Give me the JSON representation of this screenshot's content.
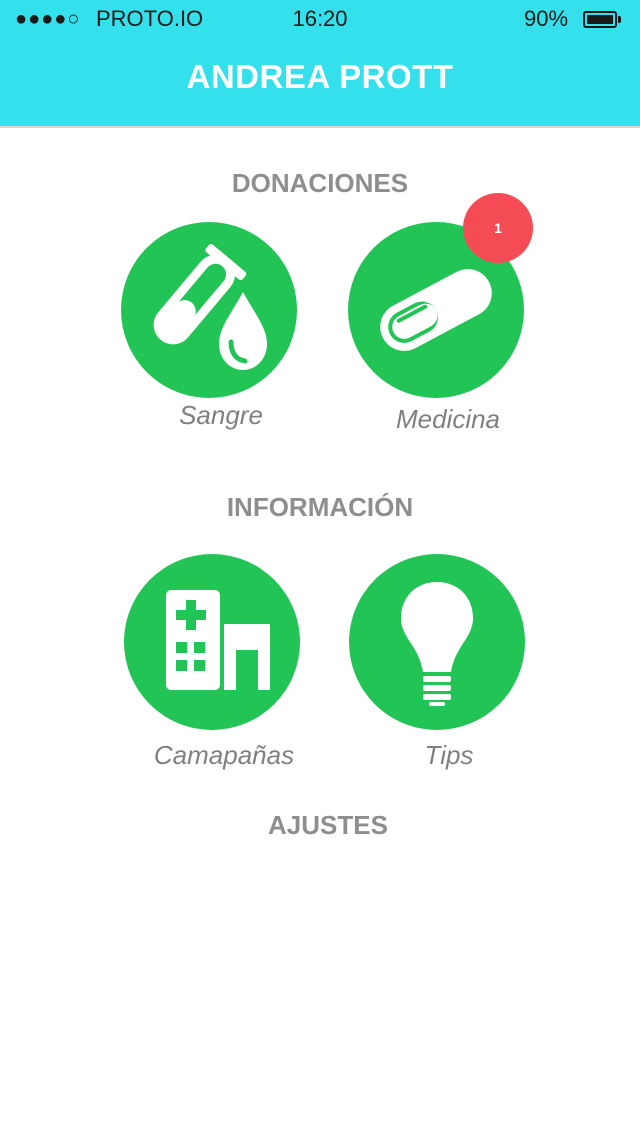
{
  "status_bar": {
    "signal": "●●●●○",
    "carrier": "PROTO.IO",
    "time": "16:20",
    "battery": "90%",
    "battery_level": 0.9
  },
  "header": {
    "title": "ANDREA PROTT"
  },
  "sections": {
    "donaciones": {
      "title": "DONACIONES",
      "items": [
        {
          "label": "Sangre",
          "icon": "blood-test-icon"
        },
        {
          "label": "Medicina",
          "icon": "pill-icon",
          "badge": "1"
        }
      ]
    },
    "informacion": {
      "title": "INFORMACIÓN",
      "items": [
        {
          "label": "Camapañas",
          "icon": "hospital-icon"
        },
        {
          "label": "Tips",
          "icon": "lightbulb-icon"
        }
      ]
    },
    "ajustes": {
      "title": "AJUSTES"
    }
  },
  "colors": {
    "header_bg": "#33e0eb",
    "tile_green": "#22c455",
    "badge_red": "#f54b55",
    "section_title": "#8e8e8e"
  }
}
